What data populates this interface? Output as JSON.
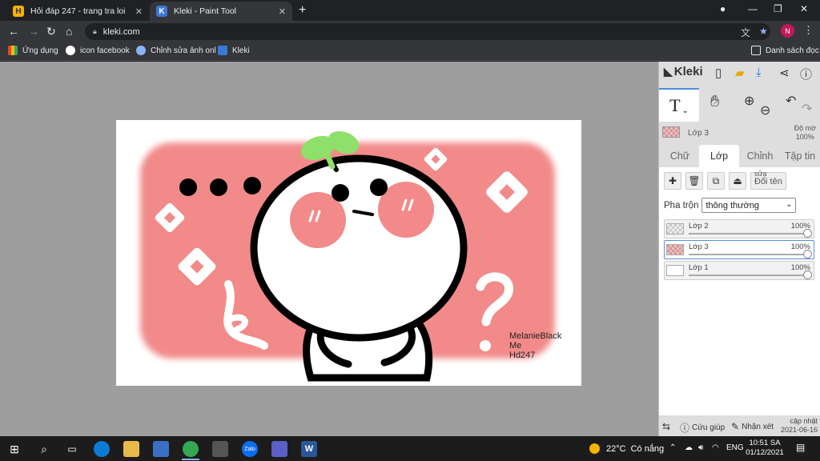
{
  "browser": {
    "tabs": [
      {
        "title": "Hỏi đáp 247 - trang tra loi",
        "favicon_letter": "H",
        "favicon_color": "#f4b400",
        "active": false
      },
      {
        "title": "Kleki - Paint Tool",
        "favicon_letter": "K",
        "favicon_color": "#3c78d8",
        "active": true
      }
    ],
    "url": "kleki.com",
    "profile_initial": "N",
    "bookmarks": [
      {
        "label": "Ứng dụng",
        "icon": "apps-grid-icon"
      },
      {
        "label": "icon facebook",
        "icon": "bookmark-favicon-icon"
      },
      {
        "label": "Chỉnh sửa ảnh onl",
        "icon": "bookmark-favicon-icon"
      },
      {
        "label": "Kleki",
        "icon": "kleki-logo-icon"
      }
    ],
    "reading_list": "Danh sách đọc"
  },
  "app": {
    "name": "Kleki",
    "layer_info": {
      "name": "Lớp 3",
      "opacity_label": "Độ mờ",
      "opacity_value": "100%"
    },
    "tabs": [
      "Chữ",
      "Lớp",
      "Chỉnh",
      "Tập tin"
    ],
    "active_tab": "Lớp",
    "rename_label": "Đổi tên",
    "rename_sub": "sửa",
    "blend_label": "Pha trộn",
    "blend_value": "thông thường",
    "layers": [
      {
        "name": "Lớp 2",
        "opacity": "100%",
        "opacity_fraction": 1.0,
        "selected": false
      },
      {
        "name": "Lớp 3",
        "opacity": "100%",
        "opacity_fraction": 1.0,
        "selected": true
      },
      {
        "name": "Lớp 1",
        "opacity": "100%",
        "opacity_fraction": 1.0,
        "selected": false
      }
    ],
    "footer": {
      "help": "Cứu giúp",
      "feedback": "Nhận xét",
      "update_label": "cập nhật",
      "update_date": "2021-06-16"
    }
  },
  "canvas": {
    "watermark_lines": [
      "MelanieBlack",
      "Me",
      "Hd247"
    ],
    "colors": {
      "background_pink": "#f28a8a",
      "sprout_green": "#8ee06a",
      "cheek_pink": "#f28a8a",
      "outline": "#000000"
    }
  },
  "taskbar": {
    "weather_temp": "22°C",
    "weather_text": "Có nắng",
    "language": "ENG",
    "time": "10:51 SA",
    "date": "01/12/2021"
  }
}
